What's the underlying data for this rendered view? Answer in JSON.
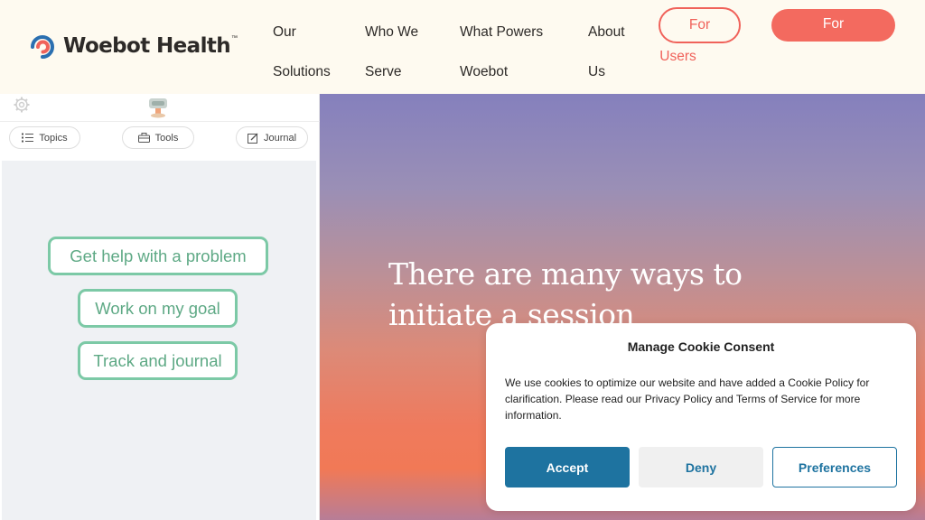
{
  "brand": {
    "name": "Woebot Health",
    "tm": "™",
    "logo_colors": [
      "#2b6fb0",
      "#f0625a"
    ]
  },
  "nav": {
    "items": [
      {
        "label": "Our Solutions"
      },
      {
        "label": "Who We Serve"
      },
      {
        "label": "What Powers Woebot"
      },
      {
        "label": "About Us"
      }
    ],
    "users_button": {
      "line1": "For",
      "line2": "Users"
    },
    "other_button": {
      "label": "For"
    }
  },
  "app": {
    "icons": {
      "settings": "gear-icon",
      "avatar": "bot-avatar-icon"
    },
    "tabs": [
      {
        "label": "Topics",
        "icon": "list-icon"
      },
      {
        "label": "Tools",
        "icon": "toolbox-icon"
      },
      {
        "label": "Journal",
        "icon": "edit-icon"
      }
    ],
    "options": [
      {
        "label": "Get help with a problem"
      },
      {
        "label": "Work on my goal"
      },
      {
        "label": "Track and journal"
      }
    ],
    "accent": "#7cc9a6"
  },
  "hero": {
    "headline": "There are many ways to initiate a session"
  },
  "cookie": {
    "title": "Manage Cookie Consent",
    "body": "We use cookies to optimize our website and have added a Cookie Policy for clarification. Please read our Privacy Policy and Terms of Service for more information.",
    "buttons": {
      "accept": "Accept",
      "deny": "Deny",
      "preferences": "Preferences"
    },
    "accent": "#1e73a0"
  }
}
